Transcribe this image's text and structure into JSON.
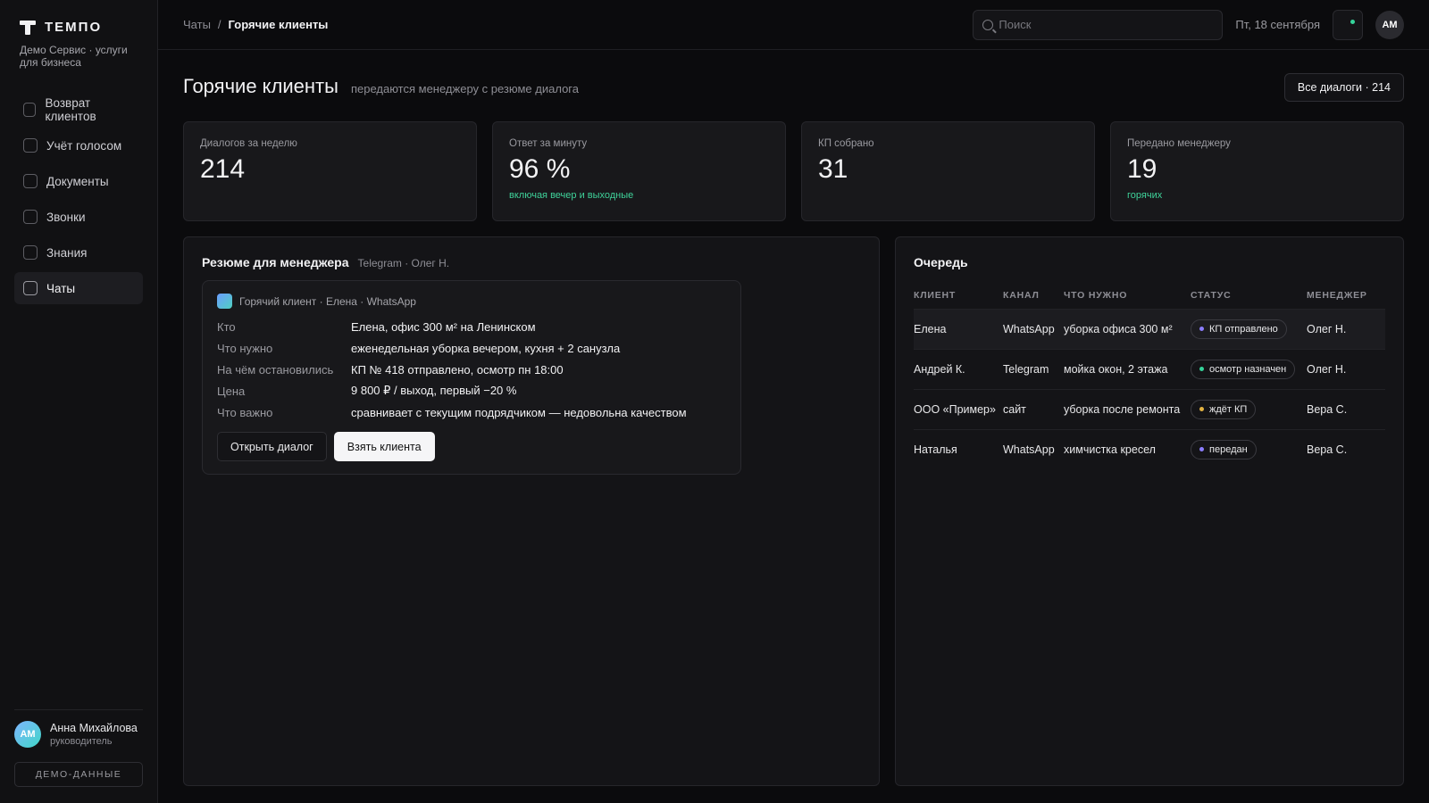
{
  "brand": {
    "name": "ТЕМПО",
    "subtitle": "Демо Сервис · услуги для бизнеса"
  },
  "sidebar": {
    "items": [
      {
        "label": "Возврат клиентов"
      },
      {
        "label": "Учёт голосом"
      },
      {
        "label": "Документы"
      },
      {
        "label": "Звонки"
      },
      {
        "label": "Знания"
      },
      {
        "label": "Чаты",
        "active": true
      }
    ],
    "user": {
      "initials": "АМ",
      "name": "Анна Михайлова",
      "role": "руководитель"
    },
    "demo_label": "ДЕМО-ДАННЫЕ"
  },
  "topbar": {
    "breadcrumb": {
      "parent": "Чаты",
      "separator": "/",
      "current": "Горячие клиенты"
    },
    "search_placeholder": "Поиск",
    "date": "Пт, 18 сентября",
    "avatar_initials": "АМ",
    "notif_color": "#35d39a"
  },
  "header": {
    "title": "Горячие клиенты",
    "subtitle": "передаются менеджеру с резюме диалога",
    "all_button": "Все диалоги · 214"
  },
  "stats": [
    {
      "label": "Диалогов за неделю",
      "value": "214",
      "note": ""
    },
    {
      "label": "Ответ за минуту",
      "value": "96 %",
      "note": "включая вечер и выходные"
    },
    {
      "label": "КП собрано",
      "value": "31",
      "note": ""
    },
    {
      "label": "Передано менеджеру",
      "value": "19",
      "note": "горячих"
    }
  ],
  "summary": {
    "title": "Резюме для менеджера",
    "meta": "Telegram · Олег Н.",
    "card_head": "Горячий клиент · Елена · WhatsApp",
    "rows": [
      {
        "key": "Кто",
        "value": "Елена, офис 300 м² на Ленинском"
      },
      {
        "key": "Что нужно",
        "value": "еженедельная уборка вечером, кухня + 2 санузла"
      },
      {
        "key": "На чём остановились",
        "value": "КП № 418 отправлено, осмотр пн 18:00"
      },
      {
        "key": "Цена",
        "value": "9 800 ₽ / выход, первый −20 %"
      },
      {
        "key": "Что важно",
        "value": "сравнивает с текущим подрядчиком — недовольна качеством"
      }
    ],
    "open_button": "Открыть диалог",
    "take_button": "Взять клиента"
  },
  "queue": {
    "title": "Очередь",
    "columns": [
      "КЛИЕНТ",
      "КАНАЛ",
      "ЧТО НУЖНО",
      "СТАТУС",
      "МЕНЕДЖЕР"
    ],
    "rows": [
      {
        "client": "Елена",
        "channel": "WhatsApp",
        "need": "уборка офиса 300 м²",
        "status": "КП отправлено",
        "status_color": "#8b7dff",
        "manager": "Олег Н."
      },
      {
        "client": "Андрей К.",
        "channel": "Telegram",
        "need": "мойка окон, 2 этажа",
        "status": "осмотр назначен",
        "status_color": "#35d39a",
        "manager": "Олег Н."
      },
      {
        "client": "ООО «Пример»",
        "channel": "сайт",
        "need": "уборка после ремонта",
        "status": "ждёт КП",
        "status_color": "#e3b341",
        "manager": "Вера С."
      },
      {
        "client": "Наталья",
        "channel": "WhatsApp",
        "need": "химчистка кресел",
        "status": "передан",
        "status_color": "#8b7dff",
        "manager": "Вера С."
      }
    ]
  }
}
